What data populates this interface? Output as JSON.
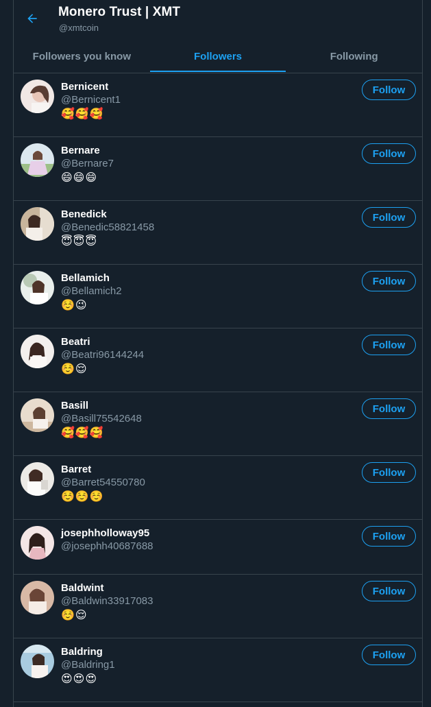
{
  "header": {
    "title": "Monero Trust | XMT",
    "subtitle": "@xmtcoin"
  },
  "tabs": [
    {
      "label": "Followers you know",
      "active": false
    },
    {
      "label": "Followers",
      "active": true
    },
    {
      "label": "Following",
      "active": false
    }
  ],
  "follow_label": "Follow",
  "users": [
    {
      "name": "Bernicent",
      "handle": "@Bernicent1",
      "bio": "🥰🥰🥰",
      "avatar_tint": "#e9dcd6"
    },
    {
      "name": "Bernare",
      "handle": "@Bernare7",
      "bio": "😄😄😄",
      "avatar_tint": "#d6c8e4"
    },
    {
      "name": "Benedick",
      "handle": "@Benedic58821458",
      "bio": "😇😇😇",
      "avatar_tint": "#d8c9b8"
    },
    {
      "name": "Bellamich",
      "handle": "@Bellamich2",
      "bio": "☺️😉",
      "avatar_tint": "#dfe4e2"
    },
    {
      "name": "Beatri",
      "handle": "@Beatri96144244",
      "bio": "☺️😌",
      "avatar_tint": "#ece6e3"
    },
    {
      "name": "Basill",
      "handle": "@Basill75542648",
      "bio": "🥰🥰🥰",
      "avatar_tint": "#e4d6c6"
    },
    {
      "name": "Barret",
      "handle": "@Barret54550780",
      "bio": "☺️☺️☺️",
      "avatar_tint": "#e6e4e0"
    },
    {
      "name": "josephholloway95",
      "handle": "@josephh40687688",
      "bio": "",
      "avatar_tint": "#e8cfd0"
    },
    {
      "name": "Baldwint",
      "handle": "@Baldwin33917083",
      "bio": "☺️😌",
      "avatar_tint": "#dcc2b4"
    },
    {
      "name": "Baldring",
      "handle": "@Baldring1",
      "bio": "😍😍😍",
      "avatar_tint": "#b9d3e0"
    }
  ]
}
